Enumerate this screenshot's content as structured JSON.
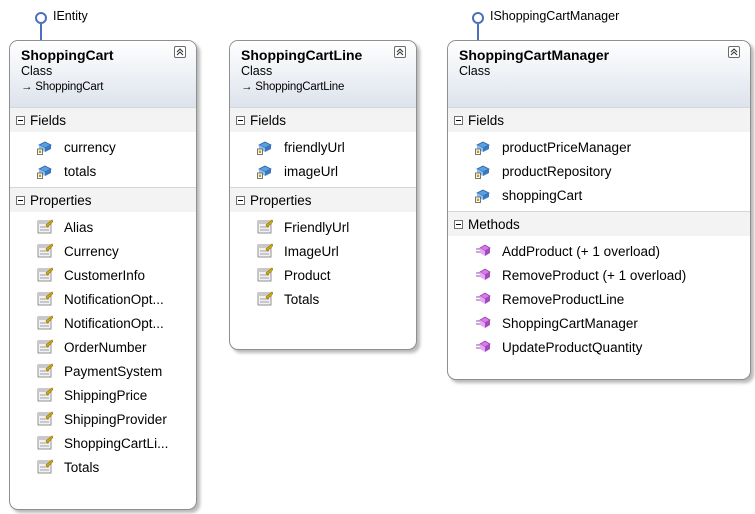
{
  "interfaces": [
    {
      "name": "IEntity"
    },
    {
      "name": "IShoppingCartManager"
    }
  ],
  "classes": [
    {
      "name": "ShoppingCart",
      "kind": "Class",
      "base": "→ ShoppingCart",
      "fields_label": "Fields",
      "fields": [
        "currency",
        "totals"
      ],
      "properties_label": "Properties",
      "properties": [
        "Alias",
        "Currency",
        "CustomerInfo",
        "NotificationOpt...",
        "NotificationOpt...",
        "OrderNumber",
        "PaymentSystem",
        "ShippingPrice",
        "ShippingProvider",
        "ShoppingCartLi...",
        "Totals"
      ]
    },
    {
      "name": "ShoppingCartLine",
      "kind": "Class",
      "base": "→ ShoppingCartLine",
      "fields_label": "Fields",
      "fields": [
        "friendlyUrl",
        "imageUrl"
      ],
      "properties_label": "Properties",
      "properties": [
        "FriendlyUrl",
        "ImageUrl",
        "Product",
        "Totals"
      ]
    },
    {
      "name": "ShoppingCartManager",
      "kind": "Class",
      "fields_label": "Fields",
      "fields": [
        "productPriceManager",
        "productRepository",
        "shoppingCart"
      ],
      "methods_label": "Methods",
      "methods": [
        "AddProduct (+ 1 overload)",
        "RemoveProduct (+ 1 overload)",
        "RemoveProductLine",
        "ShoppingCartManager",
        "UpdateProductQuantity"
      ]
    }
  ],
  "colors": {
    "interface_ring": "#4b6fc1",
    "border": "#8f8f8f",
    "header_gradient_end": "#dde3ec"
  }
}
